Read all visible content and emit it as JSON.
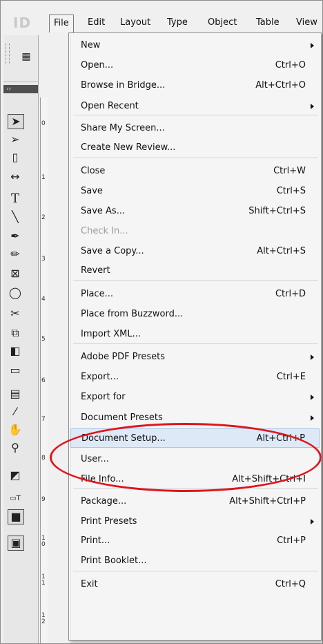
{
  "app": {
    "logo_text": "ID",
    "menubar": [
      "File",
      "Edit",
      "Layout",
      "Type",
      "Object",
      "Table",
      "View"
    ]
  },
  "ruler": {
    "numbers": [
      "0",
      "1",
      "2",
      "3",
      "4",
      "5",
      "6",
      "7",
      "8",
      "9",
      "1\n0",
      "1\n1",
      "1\n2"
    ]
  },
  "panel": {
    "strip_glyph": "››",
    "tool_label": "T"
  },
  "menu": {
    "items": [
      {
        "label": "New",
        "shortcut": "",
        "submenu": true
      },
      {
        "label": "Open...",
        "shortcut": "Ctrl+O"
      },
      {
        "label": "Browse in Bridge...",
        "shortcut": "Alt+Ctrl+O"
      },
      {
        "label": "Open Recent",
        "shortcut": "",
        "submenu": true
      },
      {
        "label": "Share My Screen...",
        "shortcut": ""
      },
      {
        "label": "Create New Review...",
        "shortcut": ""
      },
      {
        "label": "Close",
        "shortcut": "Ctrl+W"
      },
      {
        "label": "Save",
        "shortcut": "Ctrl+S"
      },
      {
        "label": "Save As...",
        "shortcut": "Shift+Ctrl+S"
      },
      {
        "label": "Check In...",
        "shortcut": "",
        "disabled": true
      },
      {
        "label": "Save a Copy...",
        "shortcut": "Alt+Ctrl+S"
      },
      {
        "label": "Revert",
        "shortcut": ""
      },
      {
        "label": "Place...",
        "shortcut": "Ctrl+D"
      },
      {
        "label": "Place from Buzzword...",
        "shortcut": ""
      },
      {
        "label": "Import XML...",
        "shortcut": ""
      },
      {
        "label": "Adobe PDF Presets",
        "shortcut": "",
        "submenu": true
      },
      {
        "label": "Export...",
        "shortcut": "Ctrl+E"
      },
      {
        "label": "Export for",
        "shortcut": "",
        "submenu": true
      },
      {
        "label": "Document Presets",
        "shortcut": "",
        "submenu": true
      },
      {
        "label": "Document Setup...",
        "shortcut": "Alt+Ctrl+P",
        "highlighted": true
      },
      {
        "label": "User...",
        "shortcut": ""
      },
      {
        "label": "File Info...",
        "shortcut": "Alt+Shift+Ctrl+I"
      },
      {
        "label": "Package...",
        "shortcut": "Alt+Shift+Ctrl+P"
      },
      {
        "label": "Print Presets",
        "shortcut": "",
        "submenu": true
      },
      {
        "label": "Print...",
        "shortcut": "Ctrl+P"
      },
      {
        "label": "Print Booklet...",
        "shortcut": ""
      },
      {
        "label": "Exit",
        "shortcut": "Ctrl+Q"
      }
    ]
  },
  "colors": {
    "highlight_bg": "#dde9f6",
    "annotation_circle": "#e0141c"
  }
}
